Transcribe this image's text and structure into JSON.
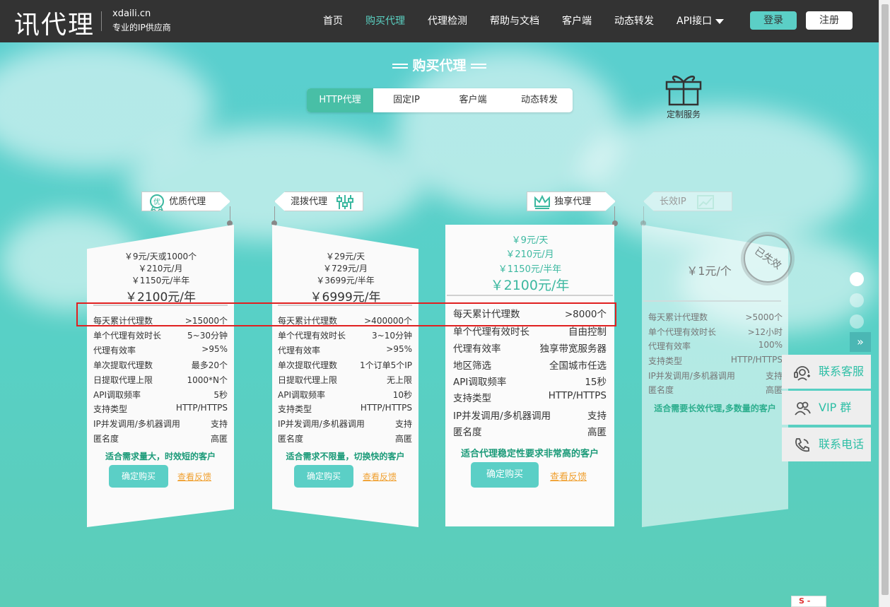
{
  "header": {
    "logo": "讯代理",
    "domain": "xdaili.cn",
    "slogan": "专业的IP供应商",
    "nav": [
      "首页",
      "购买代理",
      "代理检测",
      "帮助与文档",
      "客户端",
      "动态转发",
      "API接口"
    ],
    "active_nav": "购买代理",
    "login": "登录",
    "register": "注册"
  },
  "section_title": "购买代理",
  "tabs": [
    "HTTP代理",
    "固定IP",
    "客户端",
    "动态转发"
  ],
  "active_tab": "HTTP代理",
  "custom_service": "定制服务",
  "cards": [
    {
      "name": "优质代理",
      "prices": [
        "￥9元/天或1000个",
        "￥210元/月",
        "￥1150元/半年"
      ],
      "main_price": "￥2100元/年",
      "rows": [
        [
          "每天累计代理数",
          ">15000个"
        ],
        [
          "单个代理有效时长",
          "5~30分钟"
        ],
        [
          "代理有效率",
          ">95%"
        ],
        [
          "单次提取代理数",
          "最多20个"
        ],
        [
          "日提取代理上限",
          "1000*N个"
        ],
        [
          "API调取频率",
          "5秒"
        ],
        [
          "支持类型",
          "HTTP/HTTPS"
        ],
        [
          "IP并发调用/多机器调用",
          "支持"
        ],
        [
          "匿名度",
          "高匿"
        ]
      ],
      "hint": "适合需求量大，时效短的客户",
      "buy": "确定购买",
      "feedback": "查看反馈"
    },
    {
      "name": "混拨代理",
      "prices": [
        "￥29元/天",
        "￥729元/月",
        "￥3699元/半年"
      ],
      "main_price": "￥6999元/年",
      "rows": [
        [
          "每天累计代理数",
          ">400000个"
        ],
        [
          "单个代理有效时长",
          "3~10分钟"
        ],
        [
          "代理有效率",
          ">95%"
        ],
        [
          "单次提取代理数",
          "1个订单5个IP"
        ],
        [
          "日提取代理上限",
          "无上限"
        ],
        [
          "API调取频率",
          "10秒"
        ],
        [
          "支持类型",
          "HTTP/HTTPS"
        ],
        [
          "IP并发调用/多机器调用",
          "支持"
        ],
        [
          "匿名度",
          "高匿"
        ]
      ],
      "hint": "适合需求不限量，切换快的客户",
      "buy": "确定购买",
      "feedback": "查看反馈"
    },
    {
      "name": "独享代理",
      "prices": [
        "￥9元/天",
        "￥210元/月",
        "￥1150元/半年"
      ],
      "main_price": "￥2100元/年",
      "rows": [
        [
          "每天累计代理数",
          ">8000个"
        ],
        [
          "单个代理有效时长",
          "自由控制"
        ],
        [
          "代理有效率",
          "独享带宽服务器"
        ],
        [
          "地区筛选",
          "全国城市任选"
        ],
        [
          "API调取频率",
          "15秒"
        ],
        [
          "支持类型",
          "HTTP/HTTPS"
        ],
        [
          "IP并发调用/多机器调用",
          "支持"
        ],
        [
          "匿名度",
          "高匿"
        ]
      ],
      "hint": "适合代理稳定性要求非常高的客户",
      "buy": "确定购买",
      "feedback": "查看反馈"
    },
    {
      "name": "长效IP",
      "main_price": "￥1元/个",
      "stamp": "已失效",
      "rows": [
        [
          "每天累计代理数",
          ">5000个"
        ],
        [
          "单个代理有效时长",
          ">12小时"
        ],
        [
          "代理有效率",
          "100%"
        ],
        [
          "支持类型",
          "HTTP/HTTPS"
        ],
        [
          "IP并发调用/多机器调用",
          "支持"
        ],
        [
          "匿名度",
          "高匿"
        ]
      ],
      "hint": "适合需要长效代理,多数量的客户"
    }
  ],
  "sidebar": {
    "expand": "»",
    "service": "联系客服",
    "vip": "VIP 群",
    "phone": "联系电话"
  },
  "colors": {
    "header": "#333333",
    "accent": "#5bcfc6",
    "hint": "#1a9a78",
    "feedback": "#f0a030",
    "highlight_box": "#e02020"
  },
  "ime": "S -"
}
